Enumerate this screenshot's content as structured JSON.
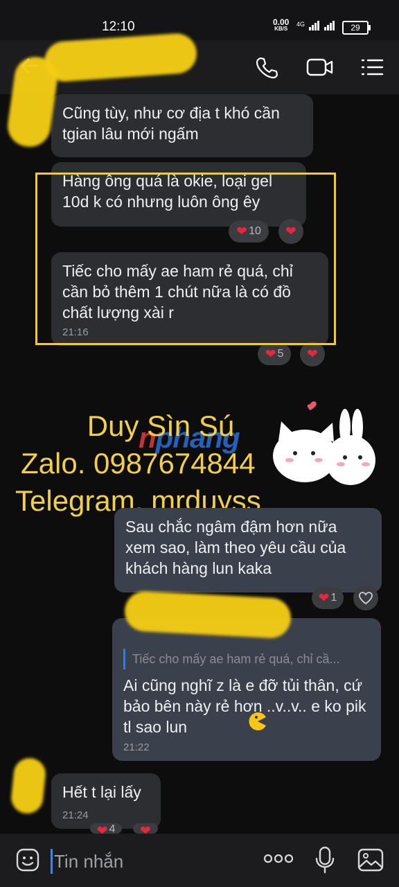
{
  "status_bar": {
    "time": "12:10",
    "speed_value": "0.00",
    "speed_unit": "KB/S",
    "network": "4G",
    "battery": "29"
  },
  "app_bar": {
    "icons": [
      "back-arrow-icon",
      "phone-icon",
      "video-call-icon",
      "menu-list-icon"
    ]
  },
  "messages": [
    {
      "text": "Cũng tùy, như cơ địa t khó cần tgian lâu mới ngấm"
    },
    {
      "text": "Hàng ông quá là okie, loại gel 10d k có nhưng luôn ông êy",
      "reaction_count": "10"
    },
    {
      "text": "Tiếc cho mấy ae ham rẻ quá, chỉ cần bỏ thêm 1 chút nữa là có đồ chất lượng xài r",
      "time": "21:16",
      "reaction_count": "5"
    },
    {
      "text": "Sau chắc ngâm đậm hơn nữa xem sao, làm theo yêu cầu của khách hàng lun kaka",
      "reaction_count": "1"
    },
    {
      "quote": "Tiếc cho mấy ae ham rẻ quá, chỉ cầ...",
      "text": "Ai cũng nghĩ z là e đỡ tủi thân, cứ bảo bên này rẻ hơn ..v..v.. e ko pik tl sao lun",
      "time": "21:22"
    },
    {
      "text": "Hết t lại lấy",
      "time": "21:24",
      "reaction_count": "4"
    }
  ],
  "watermark": {
    "line1": "Duy Sìn Sú",
    "line2": "Zalo. 0987674844",
    "line3": "Telegram. mrduyss",
    "logo_a": "n",
    "logo_b": "phang"
  },
  "input_bar": {
    "placeholder": "Tin nhắn"
  },
  "colors": {
    "highlight": "#f1ce20",
    "watermark": "#f3d043",
    "heart": "#e5283d",
    "accent": "#3a88f2"
  }
}
